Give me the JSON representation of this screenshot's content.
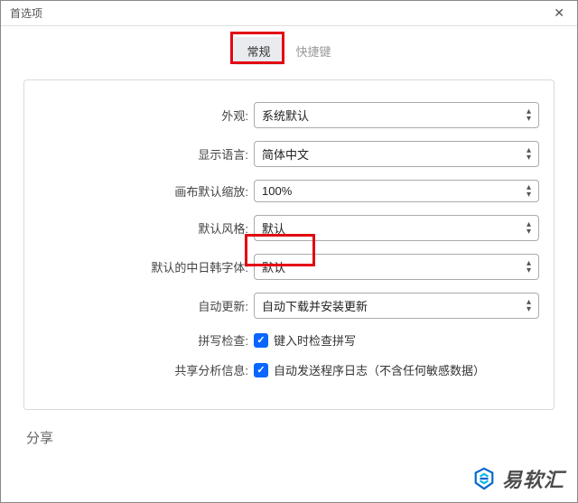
{
  "window": {
    "title": "首选项",
    "close": "✕"
  },
  "tabs": {
    "general": "常规",
    "shortcuts": "快捷键"
  },
  "form": {
    "appearance": {
      "label": "外观:",
      "value": "系统默认"
    },
    "language": {
      "label": "显示语言:",
      "value": "简体中文"
    },
    "zoom": {
      "label": "画布默认缩放:",
      "value": "100%"
    },
    "style": {
      "label": "默认风格:",
      "value": "默认"
    },
    "cjkFont": {
      "label": "默认的中日韩字体:",
      "value": "默认"
    },
    "update": {
      "label": "自动更新:",
      "value": "自动下载并安装更新"
    },
    "spellcheck": {
      "label": "拼写检查:",
      "text": "键入时检查拼写"
    },
    "analytics": {
      "label": "共享分析信息:",
      "text": "自动发送程序日志（不含任何敏感数据）"
    }
  },
  "section": {
    "share": "分享"
  },
  "watermark": "易软汇"
}
